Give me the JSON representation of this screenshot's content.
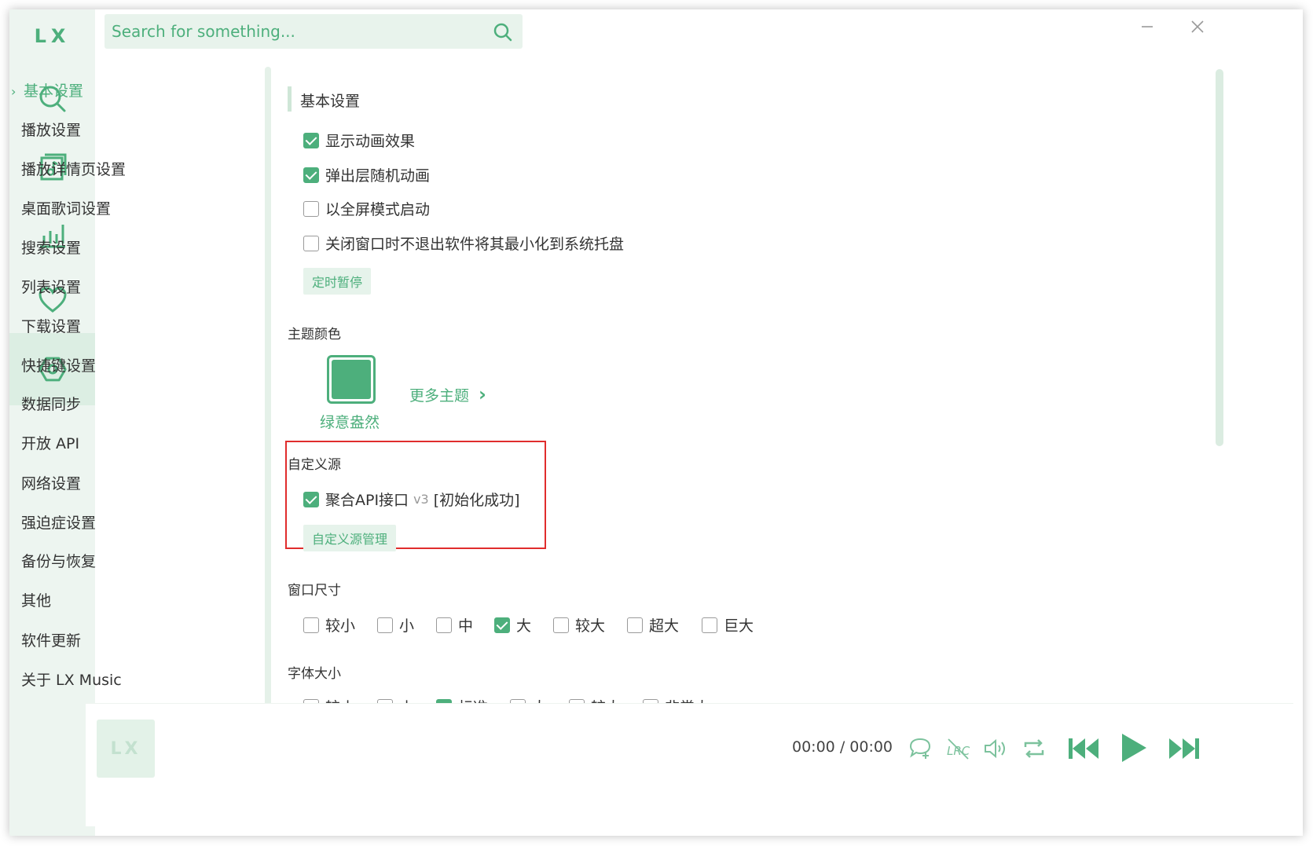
{
  "app": {
    "logo": "LX",
    "cover_logo": "LX"
  },
  "search": {
    "placeholder": "Search for something..."
  },
  "rail": [
    "search-icon",
    "music-list-icon",
    "chart-icon",
    "heart-icon",
    "settings-icon"
  ],
  "nav": {
    "active": "基本设置",
    "items": [
      "播放设置",
      "播放详情页设置",
      "桌面歌词设置",
      "搜索设置",
      "列表设置",
      "下载设置",
      "快捷键设置",
      "数据同步",
      "开放 API",
      "网络设置",
      "强迫症设置",
      "备份与恢复",
      "其他",
      "软件更新",
      "关于 LX Music"
    ]
  },
  "basic": {
    "title": "基本设置",
    "options": [
      {
        "label": "显示动画效果",
        "checked": true
      },
      {
        "label": "弹出层随机动画",
        "checked": true
      },
      {
        "label": "以全屏模式启动",
        "checked": false
      },
      {
        "label": "关闭窗口时不退出软件将其最小化到系统托盘",
        "checked": false
      }
    ],
    "timer_button": "定时暂停"
  },
  "theme": {
    "title": "主题颜色",
    "current": "绿意盎然",
    "more": "更多主题",
    "color": "#4daf7c"
  },
  "custom_source": {
    "title": "自定义源",
    "source_name": "聚合API接口",
    "source_version": "v3",
    "source_status": "[初始化成功]",
    "checked": true,
    "manage_button": "自定义源管理"
  },
  "window_size": {
    "title": "窗口尺寸",
    "options": [
      {
        "label": "较小",
        "checked": false
      },
      {
        "label": "小",
        "checked": false
      },
      {
        "label": "中",
        "checked": false
      },
      {
        "label": "大",
        "checked": true
      },
      {
        "label": "较大",
        "checked": false
      },
      {
        "label": "超大",
        "checked": false
      },
      {
        "label": "巨大",
        "checked": false
      }
    ]
  },
  "font_size": {
    "title": "字体大小",
    "options": [
      {
        "label": "较小",
        "checked": false
      },
      {
        "label": "小",
        "checked": false
      },
      {
        "label": "标准",
        "checked": true
      },
      {
        "label": "大",
        "checked": false
      },
      {
        "label": "较大",
        "checked": false
      },
      {
        "label": "非常大",
        "checked": false
      }
    ]
  },
  "player": {
    "current_time": "00:00",
    "separator": "/",
    "total_time": "00:00"
  },
  "colors": {
    "accent": "#4daf7c",
    "accent_light": "#e6f3eb",
    "highlight_border": "#e02d2d"
  }
}
